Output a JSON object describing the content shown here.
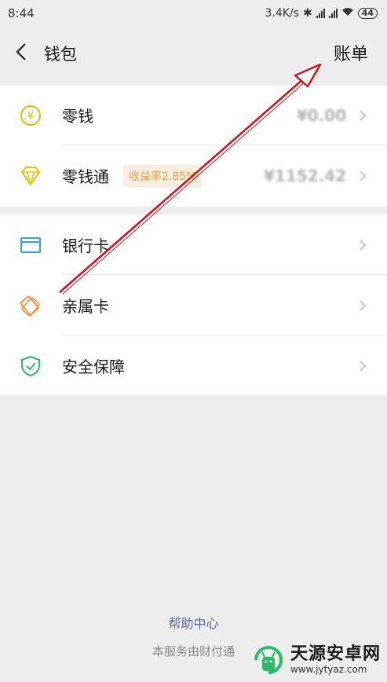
{
  "status_bar": {
    "time": "8:44",
    "speed": "3.4K/s",
    "battery": "44"
  },
  "nav": {
    "title": "钱包",
    "bill": "账单"
  },
  "group1": [
    {
      "label": "零钱",
      "value": "¥0.00",
      "icon": "yuan-coin-icon",
      "color": "#f0b400"
    },
    {
      "label": "零钱通",
      "badge": "收益率2.85%",
      "value": "¥1152.42",
      "icon": "diamond-icon",
      "color": "#f0c000"
    }
  ],
  "group2": [
    {
      "label": "银行卡",
      "icon": "bank-card-icon",
      "color": "#2aa7e8"
    },
    {
      "label": "亲属卡",
      "icon": "family-card-icon",
      "color": "#f0904a"
    },
    {
      "label": "安全保障",
      "icon": "shield-icon",
      "color": "#2bb96a"
    }
  ],
  "help": "帮助中心",
  "footer": "本服务由财付通",
  "watermark": {
    "title": "天源安卓网",
    "url": "www.jytyaz.com"
  },
  "colors": {
    "background": "#ededed",
    "link": "#576b95",
    "arrow": "#c8161d"
  }
}
